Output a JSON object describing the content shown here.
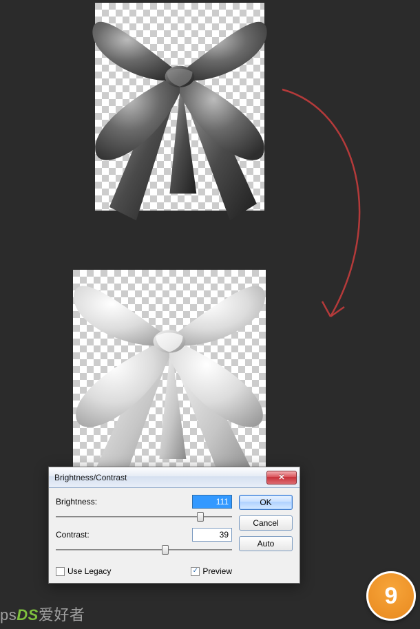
{
  "dialog": {
    "title": "Brightness/Contrast",
    "brightness_label": "Brightness:",
    "brightness_value": "111",
    "contrast_label": "Contrast:",
    "contrast_value": "39",
    "use_legacy_label": "Use Legacy",
    "preview_label": "Preview",
    "preview_checked": true,
    "ok_label": "OK",
    "cancel_label": "Cancel",
    "auto_label": "Auto",
    "close_glyph": "✕"
  },
  "slider": {
    "brightness_pos_pct": 82,
    "contrast_pos_pct": 62
  },
  "step": {
    "number": "9"
  },
  "watermark": {
    "text_prefix": "ps",
    "text_suffix": "爱好者"
  },
  "images": {
    "top_alt": "bow-ribbon-dark",
    "bottom_alt": "bow-ribbon-bright"
  },
  "colors": {
    "accent": "#3399ff",
    "arrow": "#b43a3a",
    "badge": "#ec9127"
  }
}
